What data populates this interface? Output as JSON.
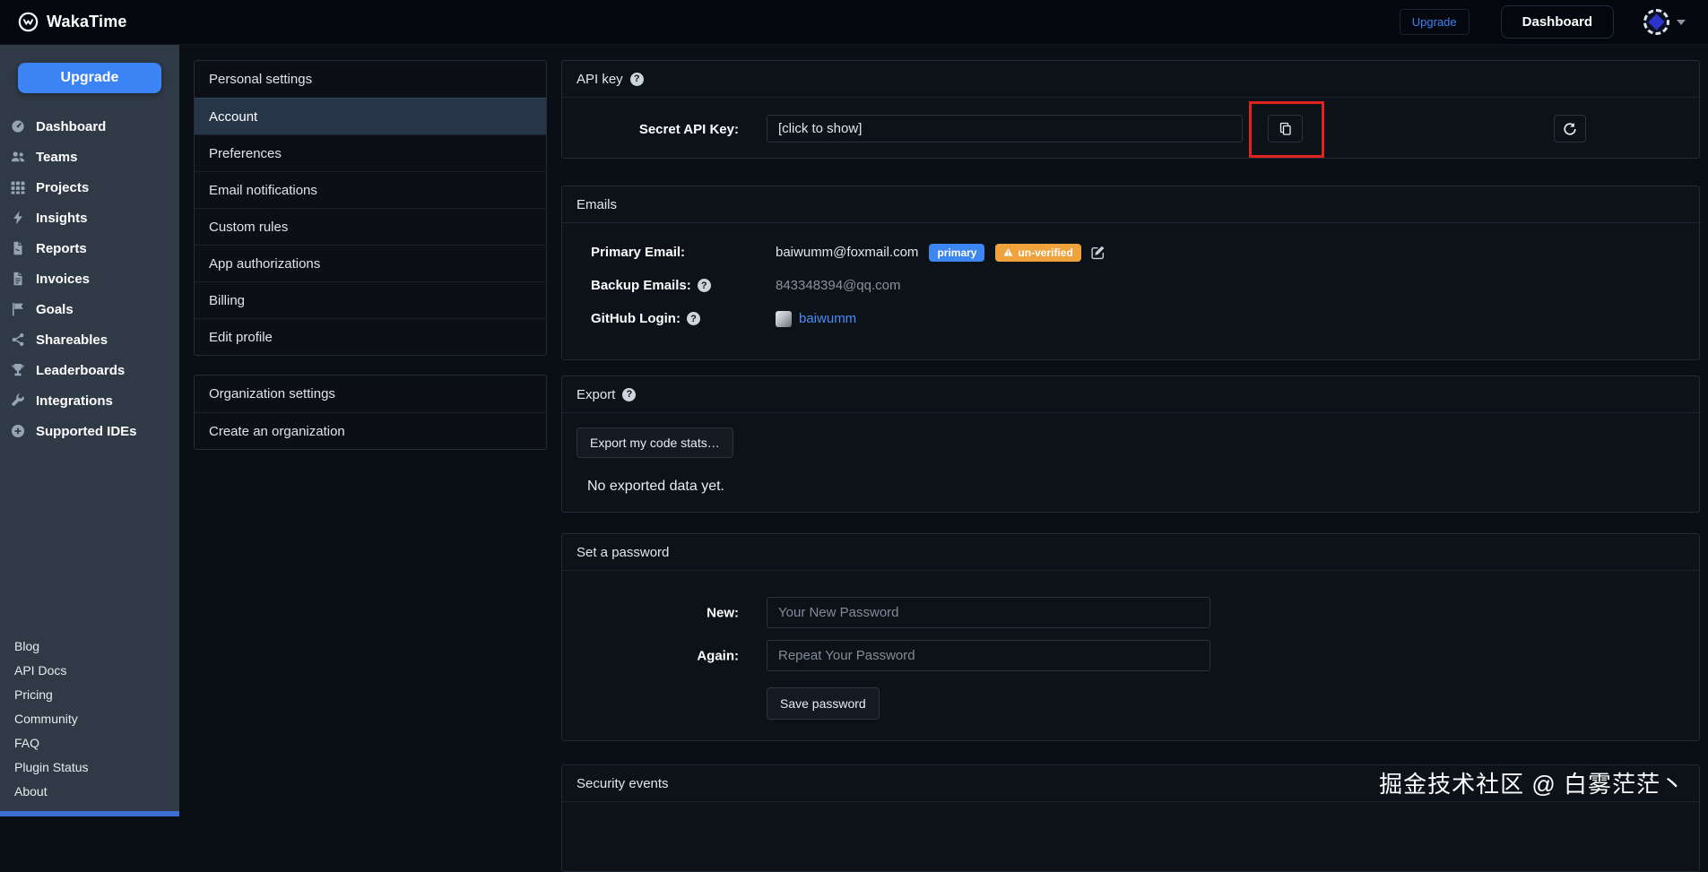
{
  "topbar": {
    "brand": "WakaTime",
    "upgrade_link": "Upgrade",
    "dashboard_button": "Dashboard"
  },
  "sidebar": {
    "upgrade_button": "Upgrade",
    "items": [
      {
        "label": "Dashboard",
        "icon": "dashboard-gauge-icon"
      },
      {
        "label": "Teams",
        "icon": "teams-users-icon"
      },
      {
        "label": "Projects",
        "icon": "projects-grid-icon"
      },
      {
        "label": "Insights",
        "icon": "insights-bolt-icon"
      },
      {
        "label": "Reports",
        "icon": "reports-file-icon"
      },
      {
        "label": "Invoices",
        "icon": "invoices-file-icon"
      },
      {
        "label": "Goals",
        "icon": "goals-flag-icon"
      },
      {
        "label": "Shareables",
        "icon": "share-icon"
      },
      {
        "label": "Leaderboards",
        "icon": "trophy-icon"
      },
      {
        "label": "Integrations",
        "icon": "wrench-icon"
      },
      {
        "label": "Supported IDEs",
        "icon": "plus-circle-icon"
      }
    ],
    "footer_links": [
      "Blog",
      "API Docs",
      "Pricing",
      "Community",
      "FAQ",
      "Plugin Status",
      "About"
    ]
  },
  "settings_nav": {
    "personal": {
      "header": "Personal settings",
      "items": [
        "Account",
        "Preferences",
        "Email notifications",
        "Custom rules",
        "App authorizations",
        "Billing",
        "Edit profile"
      ],
      "active_item": "Account"
    },
    "organization": {
      "header": "Organization settings",
      "items": [
        "Create an organization"
      ]
    }
  },
  "api_key_section": {
    "title": "API key",
    "secret_label": "Secret API Key:",
    "secret_value": "[click to show]"
  },
  "emails_section": {
    "title": "Emails",
    "primary_label": "Primary Email:",
    "primary_value": "baiwumm@foxmail.com",
    "primary_badge": "primary",
    "unverified_badge": "un-verified",
    "backup_label": "Backup Emails:",
    "backup_value": "843348394@qq.com",
    "github_label": "GitHub Login:",
    "github_value": "baiwumm"
  },
  "export_section": {
    "title": "Export",
    "export_button": "Export my code stats…",
    "empty_text": "No exported data yet."
  },
  "password_section": {
    "title": "Set a password",
    "new_label": "New:",
    "new_placeholder": "Your New Password",
    "again_label": "Again:",
    "again_placeholder": "Repeat Your Password",
    "save_button": "Save password"
  },
  "security_section": {
    "title": "Security events"
  },
  "watermark": "掘金技术社区 @ 白雾茫茫丶",
  "colors": {
    "accent": "#3c83f6",
    "badge_primary": "#3d85f0",
    "badge_warning": "#f0a23d",
    "annotation_red": "#e0231c",
    "sidebar_bg": "#2f3a46",
    "topbar_bg": "#04070d",
    "card_bg": "#0d1219"
  }
}
